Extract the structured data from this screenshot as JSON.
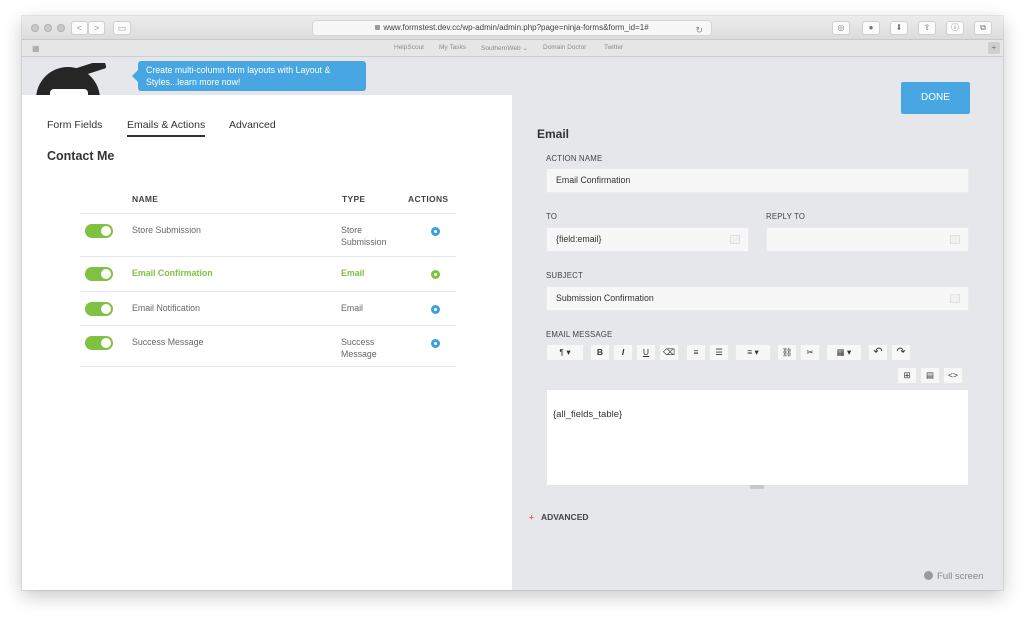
{
  "browser": {
    "url": "www.formstest.dev.cc/wp-admin/admin.php?page=ninja-forms&form_id=1#",
    "nav_back": "<",
    "nav_forward": ">",
    "bookmarks": [
      "HelpScout",
      "My Tasks",
      "SouthernWeb ⌄",
      "Domain Doctor",
      "Twitter"
    ]
  },
  "tooltip": {
    "text": "Create multi-column form layouts with Layout & Styles...learn more now!"
  },
  "tabs": [
    "Form Fields",
    "Emails & Actions",
    "Advanced"
  ],
  "active_tab": "Emails & Actions",
  "form_title": "Contact Me",
  "table": {
    "headers": {
      "name": "NAME",
      "type": "TYPE",
      "actions": "ACTIONS"
    },
    "rows": [
      {
        "name": "Store Submission",
        "type": "Store Submission",
        "enabled": true,
        "highlight": false
      },
      {
        "name": "Email Confirmation",
        "type": "Email",
        "enabled": true,
        "highlight": true
      },
      {
        "name": "Email Notification",
        "type": "Email",
        "enabled": true,
        "highlight": false
      },
      {
        "name": "Success Message",
        "type": "Success Message",
        "enabled": true,
        "highlight": false
      }
    ]
  },
  "done_label": "DONE",
  "settings": {
    "title": "Email",
    "action_name": {
      "label": "ACTION NAME",
      "value": "Email Confirmation"
    },
    "to": {
      "label": "TO",
      "value": "{field:email}"
    },
    "reply_to": {
      "label": "REPLY TO",
      "value": ""
    },
    "subject": {
      "label": "SUBJECT",
      "value": "Submission Confirmation"
    },
    "email_message": {
      "label": "EMAIL MESSAGE",
      "content": "{all_fields_table}"
    },
    "advanced_label": "ADVANCED",
    "advanced_icon": "+"
  },
  "toolbar": {
    "paragraph": "¶ ▾",
    "bold": "B",
    "italic": "I",
    "underline": "U",
    "eraser": "⌫",
    "ordered_list": "≡",
    "unordered_list": "☰",
    "align": "≡ ▾",
    "link": "⛓",
    "unlink": "✂",
    "table": "▦ ▾",
    "undo": "↶",
    "redo": "↷",
    "merge_tags": "⊞",
    "media": "▤",
    "code": "<>"
  },
  "fullscreen_label": "Full screen",
  "colors": {
    "accent": "#48a7e3",
    "toggle_on": "#7fc143",
    "panel_bg": "#e5e7ea"
  }
}
